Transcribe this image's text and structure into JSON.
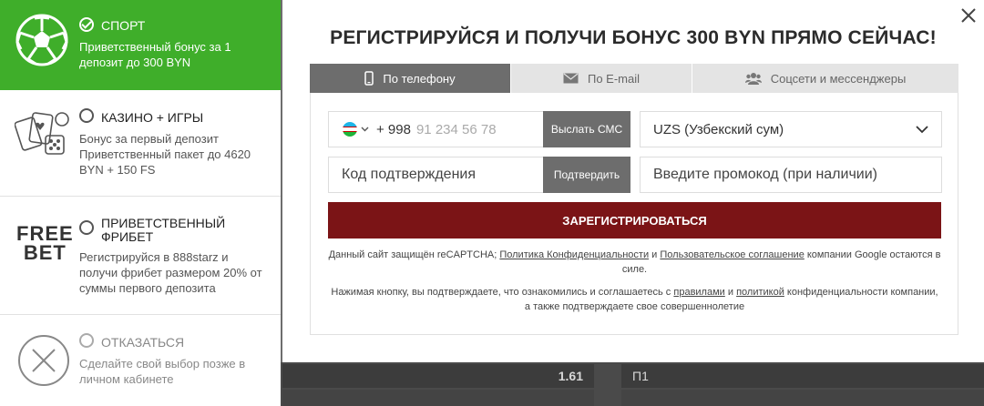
{
  "background": {
    "odds_value": "1.61",
    "label_p1": "П1"
  },
  "bonuses": {
    "sport": {
      "title": "Спорт",
      "desc": "Приветственный бонус за 1 депозит до 300 BYN"
    },
    "casino": {
      "title": "Казино + Игры",
      "desc": "Бонус за первый депозит Приветственный пакет до 4620 BYN + 150 FS"
    },
    "freebet": {
      "logo_line1": "FREE",
      "logo_line2": "BET",
      "title": "Приветственный фрибет",
      "desc": "Регистрируйся в 888starz и получи фрибет размером 20% от суммы первого депозита"
    },
    "decline": {
      "title": "Отказаться",
      "desc": "Сделайте свой выбор позже в личном кабинете"
    }
  },
  "modal": {
    "heading": "РЕГИСТРИРУЙСЯ И ПОЛУЧИ БОНУС 300 BYN ПРЯМО СЕЙЧАС!",
    "tabs": [
      {
        "label": "По телефону",
        "active": true
      },
      {
        "label": "По E-mail",
        "active": false
      },
      {
        "label": "Соцсети и мессенджеры",
        "active": false
      }
    ],
    "phone": {
      "country_code": "+ 998",
      "placeholder": "91 234 56 78",
      "send_sms": "Выслать СМС"
    },
    "currency": {
      "selected": "UZS (Узбекский сум)"
    },
    "verify": {
      "placeholder": "Код подтверждения",
      "button": "Подтвердить"
    },
    "promo": {
      "placeholder": "Введите промокод (при наличии)"
    },
    "register_button": "ЗАРЕГИСТРИРОВАТЬСЯ",
    "recaptcha": {
      "pre": "Данный сайт защищён reCAPTCHA; ",
      "privacy_link": "Политика Конфиденциальности",
      "and": " и ",
      "terms_link": "Пользовательское соглашение",
      "post": " компании Google остаются в силе."
    },
    "consent": {
      "pre": "Нажимая кнопку, вы подтверждаете, что ознакомились и соглашаетесь с ",
      "rules_link": "правилами",
      "and": " и ",
      "policy_link": "политикой",
      "post": " конфиденциальности компании, а также подтверждаете свое совершеннолетие"
    }
  },
  "colors": {
    "sport_green": "#3fae2a",
    "register_red": "#7b1416",
    "tab_active": "#6d6d6d"
  },
  "icons": [
    "soccer-ball-icon",
    "casino-cards-dice-icon",
    "freebet-logo",
    "decline-x-icon",
    "close-icon",
    "phone-icon",
    "envelope-icon",
    "users-icon",
    "uzbekistan-flag-icon",
    "chevron-down-icon"
  ]
}
